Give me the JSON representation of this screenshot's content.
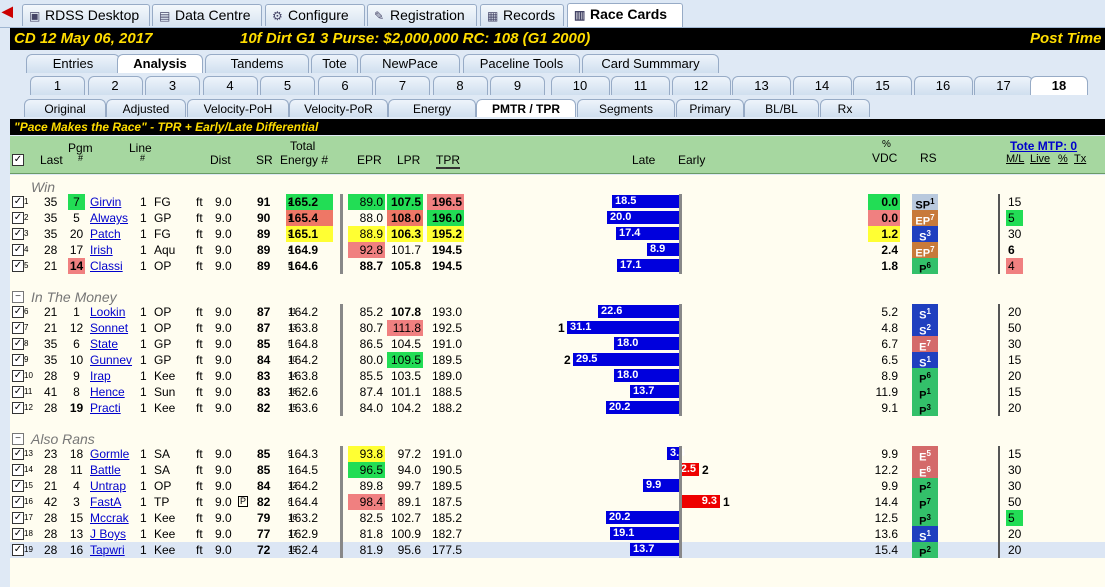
{
  "top_tabs": [
    {
      "label": "RDSS Desktop",
      "icon": "desktop-icon"
    },
    {
      "label": "Data Centre",
      "icon": "database-icon"
    },
    {
      "label": "Configure",
      "icon": "gear-icon"
    },
    {
      "label": "Registration",
      "icon": "registration-icon"
    },
    {
      "label": "Records",
      "icon": "grid-icon"
    },
    {
      "label": "Race Cards",
      "icon": "document-icon",
      "active": true
    }
  ],
  "race_header": {
    "track_date": "CD  12  May 06, 2017",
    "conditions": "10f  Dirt  G1  3  Purse: $2,000,000  RC: 108  (G1 2000)",
    "post": "Post Time"
  },
  "tabs_row1": [
    "Entries",
    "Analysis",
    "Tandems",
    "Tote",
    "NewPace",
    "Paceline Tools",
    "Card Summmary"
  ],
  "tabs_row2": [
    "1",
    "2",
    "3",
    "4",
    "5",
    "6",
    "7",
    "8",
    "9",
    "10",
    "11",
    "12",
    "13",
    "14",
    "15",
    "16",
    "17",
    "18"
  ],
  "tabs_row3": [
    "Original",
    "Adjusted",
    "Velocity-PoH",
    "Velocity-PoR",
    "Energy",
    "PMTR / TPR",
    "Segments",
    "Primary",
    "BL/BL",
    "Rx"
  ],
  "subtitle": "\"Pace Makes the Race\" - TPR + Early/Late Differential",
  "columns": {
    "last": "Last",
    "pgm": "Pgm",
    "pgm_hash": "#",
    "line": "Line",
    "line_hash": "#",
    "dist": "Dist",
    "sr": "SR",
    "total": "Total",
    "energy": "Energy #",
    "epr": "EPR",
    "lpr": "LPR",
    "tpr": "TPR",
    "late": "Late",
    "early": "Early",
    "pct": "%",
    "vdc": "VDC",
    "rs": "RS",
    "tote": "Tote MTP: 0",
    "ml": "M/L",
    "live": "Live",
    "pctlive": "%",
    "tx": "Tx"
  },
  "sections": [
    "Win",
    "In The Money",
    "Also Rans"
  ],
  "rows": [
    {
      "n": "1",
      "last": "35",
      "pgm": "7",
      "horse": "Girvin",
      "line": "1",
      "trk": "FG",
      "surf": "ft",
      "dist": "9.0",
      "sr": "91",
      "en": "165.2",
      "er": "2",
      "epr": "89.0",
      "lpr": "107.5",
      "tpr": "196.5",
      "bar": "18.5",
      "vdc": "0.0",
      "rs": "SP",
      "rsn": "1",
      "ml": "15"
    },
    {
      "n": "2",
      "last": "35",
      "pgm": "5",
      "horse": "Always",
      "line": "1",
      "trk": "GP",
      "surf": "ft",
      "dist": "9.0",
      "sr": "90",
      "en": "165.4",
      "er": "1",
      "epr": "88.0",
      "lpr": "108.0",
      "tpr": "196.0",
      "bar": "20.0",
      "vdc": "0.0",
      "rs": "EP",
      "rsn": "7",
      "ml": "5"
    },
    {
      "n": "3",
      "last": "35",
      "pgm": "20",
      "horse": "Patch",
      "line": "1",
      "trk": "FG",
      "surf": "ft",
      "dist": "9.0",
      "sr": "89",
      "en": "165.1",
      "er": "3",
      "epr": "88.9",
      "lpr": "106.3",
      "tpr": "195.2",
      "bar": "17.4",
      "vdc": "1.2",
      "rs": "S",
      "rsn": "3",
      "ml": "30"
    },
    {
      "n": "4",
      "last": "28",
      "pgm": "17",
      "horse": "Irish",
      "line": "1",
      "trk": "Aqu",
      "surf": "ft",
      "dist": "9.0",
      "sr": "89",
      "en": "164.9",
      "er": "4",
      "epr": "92.8",
      "lpr": "101.7",
      "tpr": "194.5",
      "bar": "8.9",
      "vdc": "2.4",
      "rs": "EP",
      "rsn": "7",
      "ml": "6"
    },
    {
      "n": "5",
      "last": "21",
      "pgm": "14",
      "horse": "Classi",
      "line": "1",
      "trk": "OP",
      "surf": "ft",
      "dist": "9.0",
      "sr": "89",
      "en": "164.6",
      "er": "5",
      "epr": "88.7",
      "lpr": "105.8",
      "tpr": "194.5",
      "bar": "17.1",
      "vdc": "1.8",
      "rs": "P",
      "rsn": "6",
      "ml": "4"
    },
    {
      "n": "6",
      "last": "21",
      "pgm": "1",
      "horse": "Lookin",
      "line": "1",
      "trk": "OP",
      "surf": "ft",
      "dist": "9.0",
      "sr": "87",
      "en": "164.2",
      "er": "11",
      "epr": "85.2",
      "lpr": "107.8",
      "tpr": "193.0",
      "bar": "22.6",
      "vdc": "5.2",
      "rs": "S",
      "rsn": "1",
      "ml": "20"
    },
    {
      "n": "7",
      "last": "21",
      "pgm": "12",
      "horse": "Sonnet",
      "line": "1",
      "trk": "OP",
      "surf": "ft",
      "dist": "9.0",
      "sr": "87",
      "en": "163.8",
      "er": "13",
      "epr": "80.7",
      "lpr": "111.8",
      "tpr": "192.5",
      "bar": "31.1",
      "rank": "1",
      "vdc": "4.8",
      "rs": "S",
      "rsn": "2",
      "ml": "50"
    },
    {
      "n": "8",
      "last": "35",
      "pgm": "6",
      "horse": "State",
      "line": "1",
      "trk": "GP",
      "surf": "ft",
      "dist": "9.0",
      "sr": "85",
      "en": "164.8",
      "er": "5",
      "epr": "86.5",
      "lpr": "104.5",
      "tpr": "191.0",
      "bar": "18.0",
      "vdc": "6.7",
      "rs": "E",
      "rsn": "7",
      "ml": "30"
    },
    {
      "n": "9",
      "last": "35",
      "pgm": "10",
      "horse": "Gunnev",
      "line": "1",
      "trk": "GP",
      "surf": "ft",
      "dist": "9.0",
      "sr": "84",
      "en": "164.2",
      "er": "10",
      "epr": "80.0",
      "lpr": "109.5",
      "tpr": "189.5",
      "bar": "29.5",
      "rank": "2",
      "vdc": "6.5",
      "rs": "S",
      "rsn": "1",
      "ml": "15"
    },
    {
      "n": "10",
      "last": "28",
      "pgm": "9",
      "horse": "Irap",
      "line": "1",
      "trk": "Kee",
      "surf": "ft",
      "dist": "9.0",
      "sr": "83",
      "en": "163.8",
      "er": "14",
      "epr": "85.5",
      "lpr": "103.5",
      "tpr": "189.0",
      "bar": "18.0",
      "vdc": "8.9",
      "rs": "P",
      "rsn": "6",
      "ml": "20"
    },
    {
      "n": "11",
      "last": "41",
      "pgm": "8",
      "horse": "Hence",
      "line": "1",
      "trk": "Sun",
      "surf": "ft",
      "dist": "9.0",
      "sr": "83",
      "en": "162.6",
      "er": "18",
      "epr": "87.4",
      "lpr": "101.1",
      "tpr": "188.5",
      "bar": "13.7",
      "vdc": "11.9",
      "rs": "P",
      "rsn": "1",
      "ml": "15"
    },
    {
      "n": "12",
      "last": "28",
      "pgm": "19",
      "horse": "Practi",
      "line": "1",
      "trk": "Kee",
      "surf": "ft",
      "dist": "9.0",
      "sr": "82",
      "en": "163.6",
      "er": "15",
      "epr": "84.0",
      "lpr": "104.2",
      "tpr": "188.2",
      "bar": "20.2",
      "vdc": "9.1",
      "rs": "P",
      "rsn": "3",
      "ml": "20"
    },
    {
      "n": "13",
      "last": "23",
      "pgm": "18",
      "horse": "Gormle",
      "line": "1",
      "trk": "SA",
      "surf": "ft",
      "dist": "9.0",
      "sr": "85",
      "en": "164.3",
      "er": "9",
      "epr": "93.8",
      "lpr": "97.2",
      "tpr": "191.0",
      "bar": "3.4",
      "vdc": "9.9",
      "rs": "E",
      "rsn": "5",
      "ml": "15"
    },
    {
      "n": "14",
      "last": "28",
      "pgm": "11",
      "horse": "Battle",
      "line": "1",
      "trk": "SA",
      "surf": "ft",
      "dist": "9.0",
      "sr": "85",
      "en": "164.5",
      "er": "7",
      "epr": "96.5",
      "lpr": "94.0",
      "tpr": "190.5",
      "bar": "2.5",
      "early": true,
      "rank": "2",
      "vdc": "12.2",
      "rs": "E",
      "rsn": "6",
      "ml": "30"
    },
    {
      "n": "15",
      "last": "21",
      "pgm": "4",
      "horse": "Untrap",
      "line": "1",
      "trk": "OP",
      "surf": "ft",
      "dist": "9.0",
      "sr": "84",
      "en": "164.2",
      "er": "12",
      "epr": "89.8",
      "lpr": "99.7",
      "tpr": "189.5",
      "bar": "9.9",
      "vdc": "9.9",
      "rs": "P",
      "rsn": "2",
      "ml": "30"
    },
    {
      "n": "16",
      "last": "42",
      "pgm": "3",
      "horse": "FastA",
      "line": "1",
      "trk": "TP",
      "surf": "ft",
      "dist": "9.0",
      "box": "P",
      "sr": "82",
      "en": "164.4",
      "er": "8",
      "epr": "98.4",
      "lpr": "89.1",
      "tpr": "187.5",
      "bar": "9.3",
      "early": true,
      "rank": "1",
      "vdc": "14.4",
      "rs": "P",
      "rsn": "7",
      "ml": "50"
    },
    {
      "n": "17",
      "last": "28",
      "pgm": "15",
      "horse": "Mccrak",
      "line": "1",
      "trk": "Kee",
      "surf": "ft",
      "dist": "9.0",
      "sr": "79",
      "en": "163.2",
      "er": "16",
      "epr": "82.5",
      "lpr": "102.7",
      "tpr": "185.2",
      "bar": "20.2",
      "vdc": "12.5",
      "rs": "P",
      "rsn": "3",
      "ml": "5"
    },
    {
      "n": "18",
      "last": "28",
      "pgm": "13",
      "horse": "J Boys",
      "line": "1",
      "trk": "Kee",
      "surf": "ft",
      "dist": "9.0",
      "sr": "77",
      "en": "162.9",
      "er": "17",
      "epr": "81.8",
      "lpr": "100.9",
      "tpr": "182.7",
      "bar": "19.1",
      "vdc": "13.6",
      "rs": "S",
      "rsn": "1",
      "ml": "20"
    },
    {
      "n": "19",
      "last": "28",
      "pgm": "16",
      "horse": "Tapwri",
      "line": "1",
      "trk": "Kee",
      "surf": "ft",
      "dist": "9.0",
      "sr": "72",
      "en": "162.4",
      "er": "19",
      "epr": "81.9",
      "lpr": "95.6",
      "tpr": "177.5",
      "bar": "13.7",
      "vdc": "15.4",
      "rs": "P",
      "rsn": "2",
      "ml": "20"
    }
  ],
  "colors": {
    "header_bg": "#000000",
    "header_text": "#ffdd00",
    "col_header_bg": "#a6d7a0",
    "late_bar": "#0000dd",
    "early_bar": "#ee0000",
    "highlight_green": "#22dd55",
    "highlight_yellow": "#ffff33",
    "highlight_red": "#f08080"
  }
}
